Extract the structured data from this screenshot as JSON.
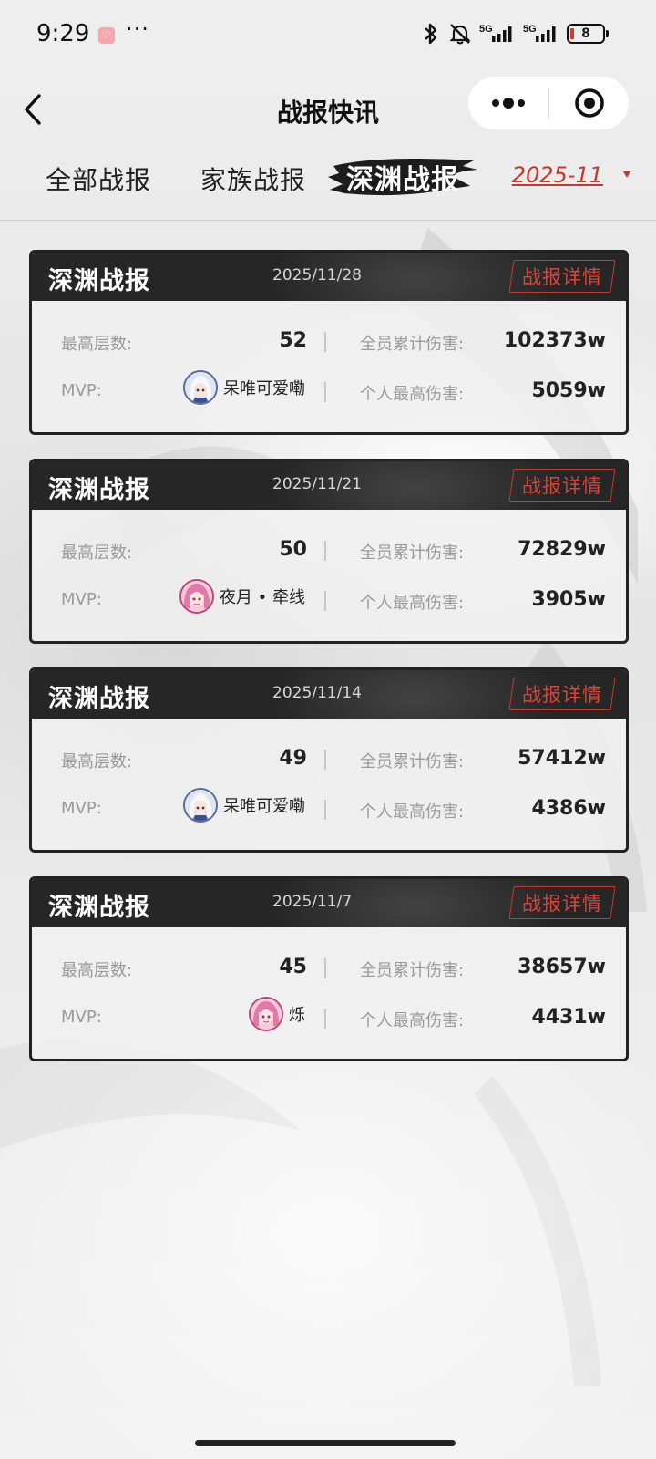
{
  "status_bar": {
    "time": "9:29",
    "app_badge_icon": "gallery-app-icon",
    "more": "···",
    "network_1": "5G",
    "network_2": "5G",
    "battery": "8",
    "icons": [
      "bluetooth-icon",
      "bell-muted-icon",
      "signal-icon",
      "battery-icon"
    ]
  },
  "nav": {
    "title": "战报快讯",
    "back_icon": "chevron-left-icon",
    "more_icon": "more-dots-icon",
    "close_icon": "target-close-icon"
  },
  "tabs": {
    "items": [
      {
        "label": "全部战报",
        "active": false
      },
      {
        "label": "家族战报",
        "active": false
      },
      {
        "label": "深渊战报",
        "active": true
      }
    ],
    "month": "2025-11"
  },
  "labels": {
    "floor": "最高层数:",
    "total_damage": "全员累计伤害:",
    "mvp": "MVP:",
    "personal_damage": "个人最高伤害:",
    "detail": "战报详情"
  },
  "colors": {
    "accent_red": "#c23a2e",
    "header_dark": "#262626"
  },
  "reports": [
    {
      "title": "深渊战报",
      "date": "2025/11/28",
      "floor": "52",
      "total_damage": "102373w",
      "mvp_name": "呆唯可爱嘞",
      "mvp_avatar": "white-hair-avatar",
      "personal_damage": "5059w"
    },
    {
      "title": "深渊战报",
      "date": "2025/11/21",
      "floor": "50",
      "total_damage": "72829w",
      "mvp_name": "夜月 • 牵线",
      "mvp_avatar": "pink-hair-avatar",
      "personal_damage": "3905w"
    },
    {
      "title": "深渊战报",
      "date": "2025/11/14",
      "floor": "49",
      "total_damage": "57412w",
      "mvp_name": "呆唯可爱嘞",
      "mvp_avatar": "white-hair-avatar",
      "personal_damage": "4386w"
    },
    {
      "title": "深渊战报",
      "date": "2025/11/7",
      "floor": "45",
      "total_damage": "38657w",
      "mvp_name": "烁",
      "mvp_avatar": "pink-hair-avatar",
      "personal_damage": "4431w"
    }
  ]
}
